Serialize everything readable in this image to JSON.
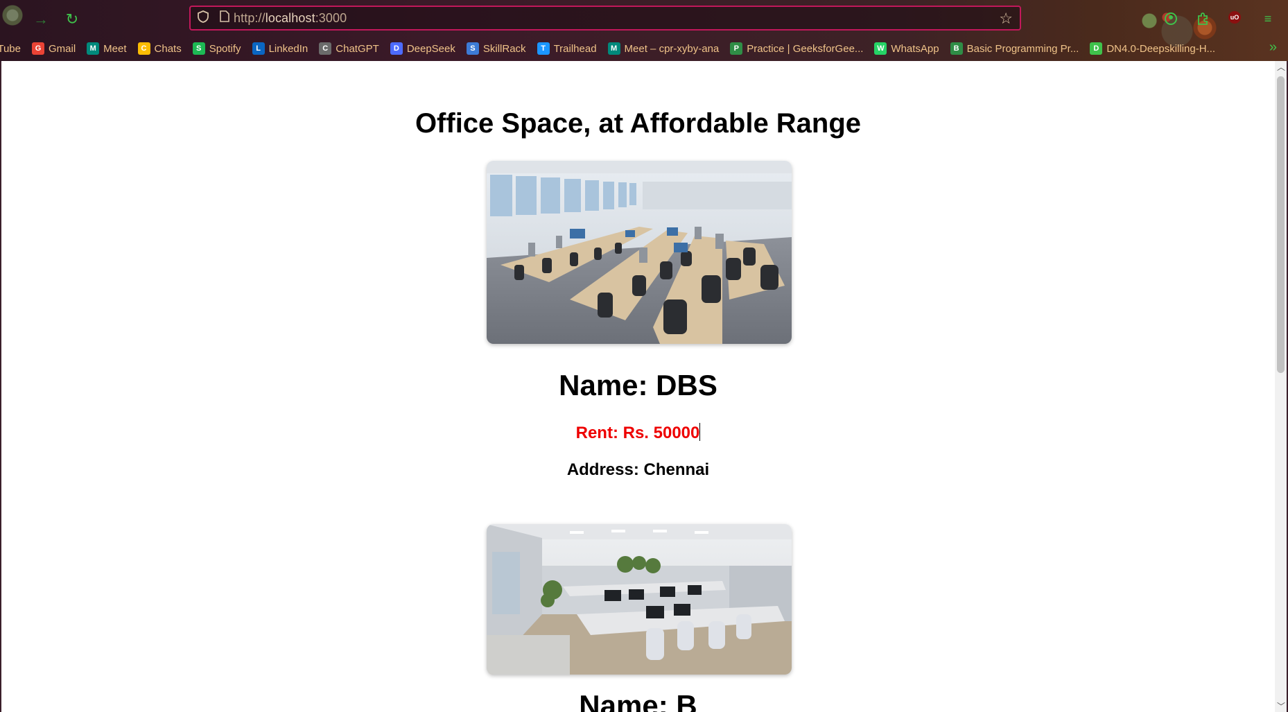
{
  "browser": {
    "url_scheme": "http://",
    "url_host": "localhost",
    "url_port": ":3000",
    "bookmarks": [
      {
        "label": "uTube",
        "icon": "youtube-icon",
        "color": "#ff0000"
      },
      {
        "label": "Gmail",
        "icon": "gmail-icon",
        "color": "#ea4335"
      },
      {
        "label": "Meet",
        "icon": "meet-icon",
        "color": "#00897b"
      },
      {
        "label": "Chats",
        "icon": "chats-icon",
        "color": "#fbbc04"
      },
      {
        "label": "Spotify",
        "icon": "spotify-icon",
        "color": "#1db954"
      },
      {
        "label": "LinkedIn",
        "icon": "linkedin-icon",
        "color": "#0a66c2"
      },
      {
        "label": "ChatGPT",
        "icon": "chatgpt-icon",
        "color": "#6b6b6b"
      },
      {
        "label": "DeepSeek",
        "icon": "deepseek-icon",
        "color": "#4d6bfe"
      },
      {
        "label": "SkillRack",
        "icon": "skillrack-icon",
        "color": "#3d7bd6"
      },
      {
        "label": "Trailhead",
        "icon": "trailhead-icon",
        "color": "#1b96ff"
      },
      {
        "label": "Meet – cpr-xyby-ana",
        "icon": "meet-icon",
        "color": "#00897b"
      },
      {
        "label": "Practice | GeeksforGee...",
        "icon": "geeksforgeeks-icon",
        "color": "#2f8d46"
      },
      {
        "label": "WhatsApp",
        "icon": "whatsapp-icon",
        "color": "#25d366"
      },
      {
        "label": "Basic Programming Pr...",
        "icon": "geeksforgeeks-icon",
        "color": "#2f8d46"
      },
      {
        "label": "DN4.0-Deepskilling-H...",
        "icon": "globe-icon",
        "color": "#3fc24b"
      }
    ]
  },
  "page": {
    "title": "Office Space, at Affordable Range",
    "offices": [
      {
        "name": "Name: DBS",
        "rent": "Rent: Rs. 50000",
        "address": "Address: Chennai",
        "image": "office-photo-1"
      },
      {
        "name": "Name: B",
        "image": "office-photo-2"
      }
    ]
  },
  "colors": {
    "rent_text": "#ee0000",
    "accent_green": "#3fc24b",
    "bookmark_text": "#f0c389",
    "urlbar_border": "#c2185b"
  }
}
